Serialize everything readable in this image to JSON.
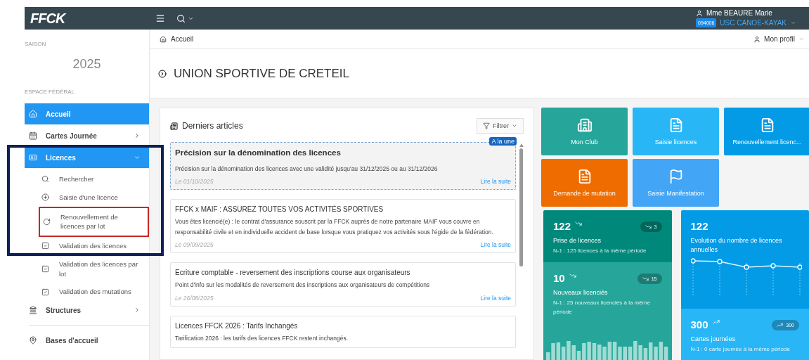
{
  "header": {
    "logo": "FFCK",
    "user_name": "Mme BEAURE Marie",
    "club_code": "094006",
    "club_name": "USC CANOE-KAYAK"
  },
  "breadcrumb": "Accueil",
  "profile": "Mon profil",
  "sidebar": {
    "season_label": "SAISON",
    "season": "2025",
    "section_label": "ESPACE FÉDÉRAL",
    "items": [
      {
        "label": "Accueil",
        "selected": true,
        "has_arrow": false,
        "framed": false
      },
      {
        "label": "Cartes Journée",
        "selected": false,
        "has_arrow": true,
        "framed": false
      },
      {
        "label": "Licences",
        "selected": true,
        "has_arrow": true,
        "expanded": true,
        "framed": true,
        "children": [
          {
            "label": "Rechercher",
            "framed": false
          },
          {
            "label": "Saisie d'une licence",
            "framed": false
          },
          {
            "label": "Renouvellement de licences par lot",
            "framed": true
          },
          {
            "label": "Validation des licences",
            "framed": false
          },
          {
            "label": "Validation des licences par lot",
            "framed": false
          },
          {
            "label": "Validation des mutations",
            "framed": false
          }
        ]
      },
      {
        "label": "Structures",
        "selected": false,
        "has_arrow": true,
        "framed": false
      },
      {
        "label": "Bases d'accueil",
        "selected": false,
        "has_arrow": false,
        "framed": false
      }
    ]
  },
  "page_title": "UNION SPORTIVE DE CRETEIL",
  "articles_panel": {
    "title": "Derniers articles",
    "filter": "Filtrer",
    "articles": [
      {
        "title": "Précision sur la dénomination des licences",
        "featured": true,
        "badge": "A la une",
        "body": "Précision sur la dénomination des licences avec une validité jusqu'au 31/12/2025 ou au 31/12/2026",
        "date": "Le 01/10/2025",
        "link": "Lire la suite"
      },
      {
        "title": "FFCK x MAIF : ASSUREZ TOUTES VOS ACTIVITÉS SPORTIVES",
        "featured": false,
        "body": "Vous êtes licencié(e) : le contrat d'assurance souscrit par la FFCK auprès de notre partenaire MAIF vous couvre en responsabilité civile et en individuelle accident de base lorsque vous pratiquez vos activités sous l'égide de la fédération.",
        "date": "Le 09/09/2025",
        "link": "Lire la suite"
      },
      {
        "title": "Ecriture comptable - reversement des inscriptions course aux organisateurs",
        "featured": false,
        "body": "Point d'info sur les modalités de reversement des inscriptions aux organisateurs de compétitions",
        "date": "Le 26/08/2025",
        "link": "Lire la suite"
      },
      {
        "title": "Licences FFCK 2026 : Tarifs Inchangés",
        "featured": false,
        "body": "Tarification 2026 : les tarifs des licences FFCK restent inchangés."
      }
    ]
  },
  "tiles": [
    {
      "label": "Mon Club",
      "kind": "building",
      "color": "#26a69a"
    },
    {
      "label": "Saisie licences",
      "kind": "card",
      "color": "#29b6f6"
    },
    {
      "label": "Renouvellement licenc...",
      "kind": "card",
      "color": "#039be5"
    },
    {
      "label": "Demande de mutation",
      "kind": "card",
      "color": "#ef6c00"
    },
    {
      "label": "Saisie Manifestation",
      "kind": "flag",
      "color": "#42a5f5"
    }
  ],
  "stats_left": [
    {
      "value": "122",
      "rising": false,
      "badge": "3",
      "label": "Prise de licences",
      "note": "N-1 : 125 licences à la même période"
    },
    {
      "value": "10",
      "rising": false,
      "badge": "15",
      "label": "Nouveaux licenciés",
      "note": "N-1 : 25 nouveaux licenciés à la même période"
    }
  ],
  "stats_right": {
    "value": "122",
    "label": "Evolution du nombre de licences annuelles",
    "card": {
      "value": "300",
      "rising": true,
      "badge": "300",
      "label": "Cartes journées",
      "note": "N-1 : 0 carte journée à la même période"
    }
  }
}
